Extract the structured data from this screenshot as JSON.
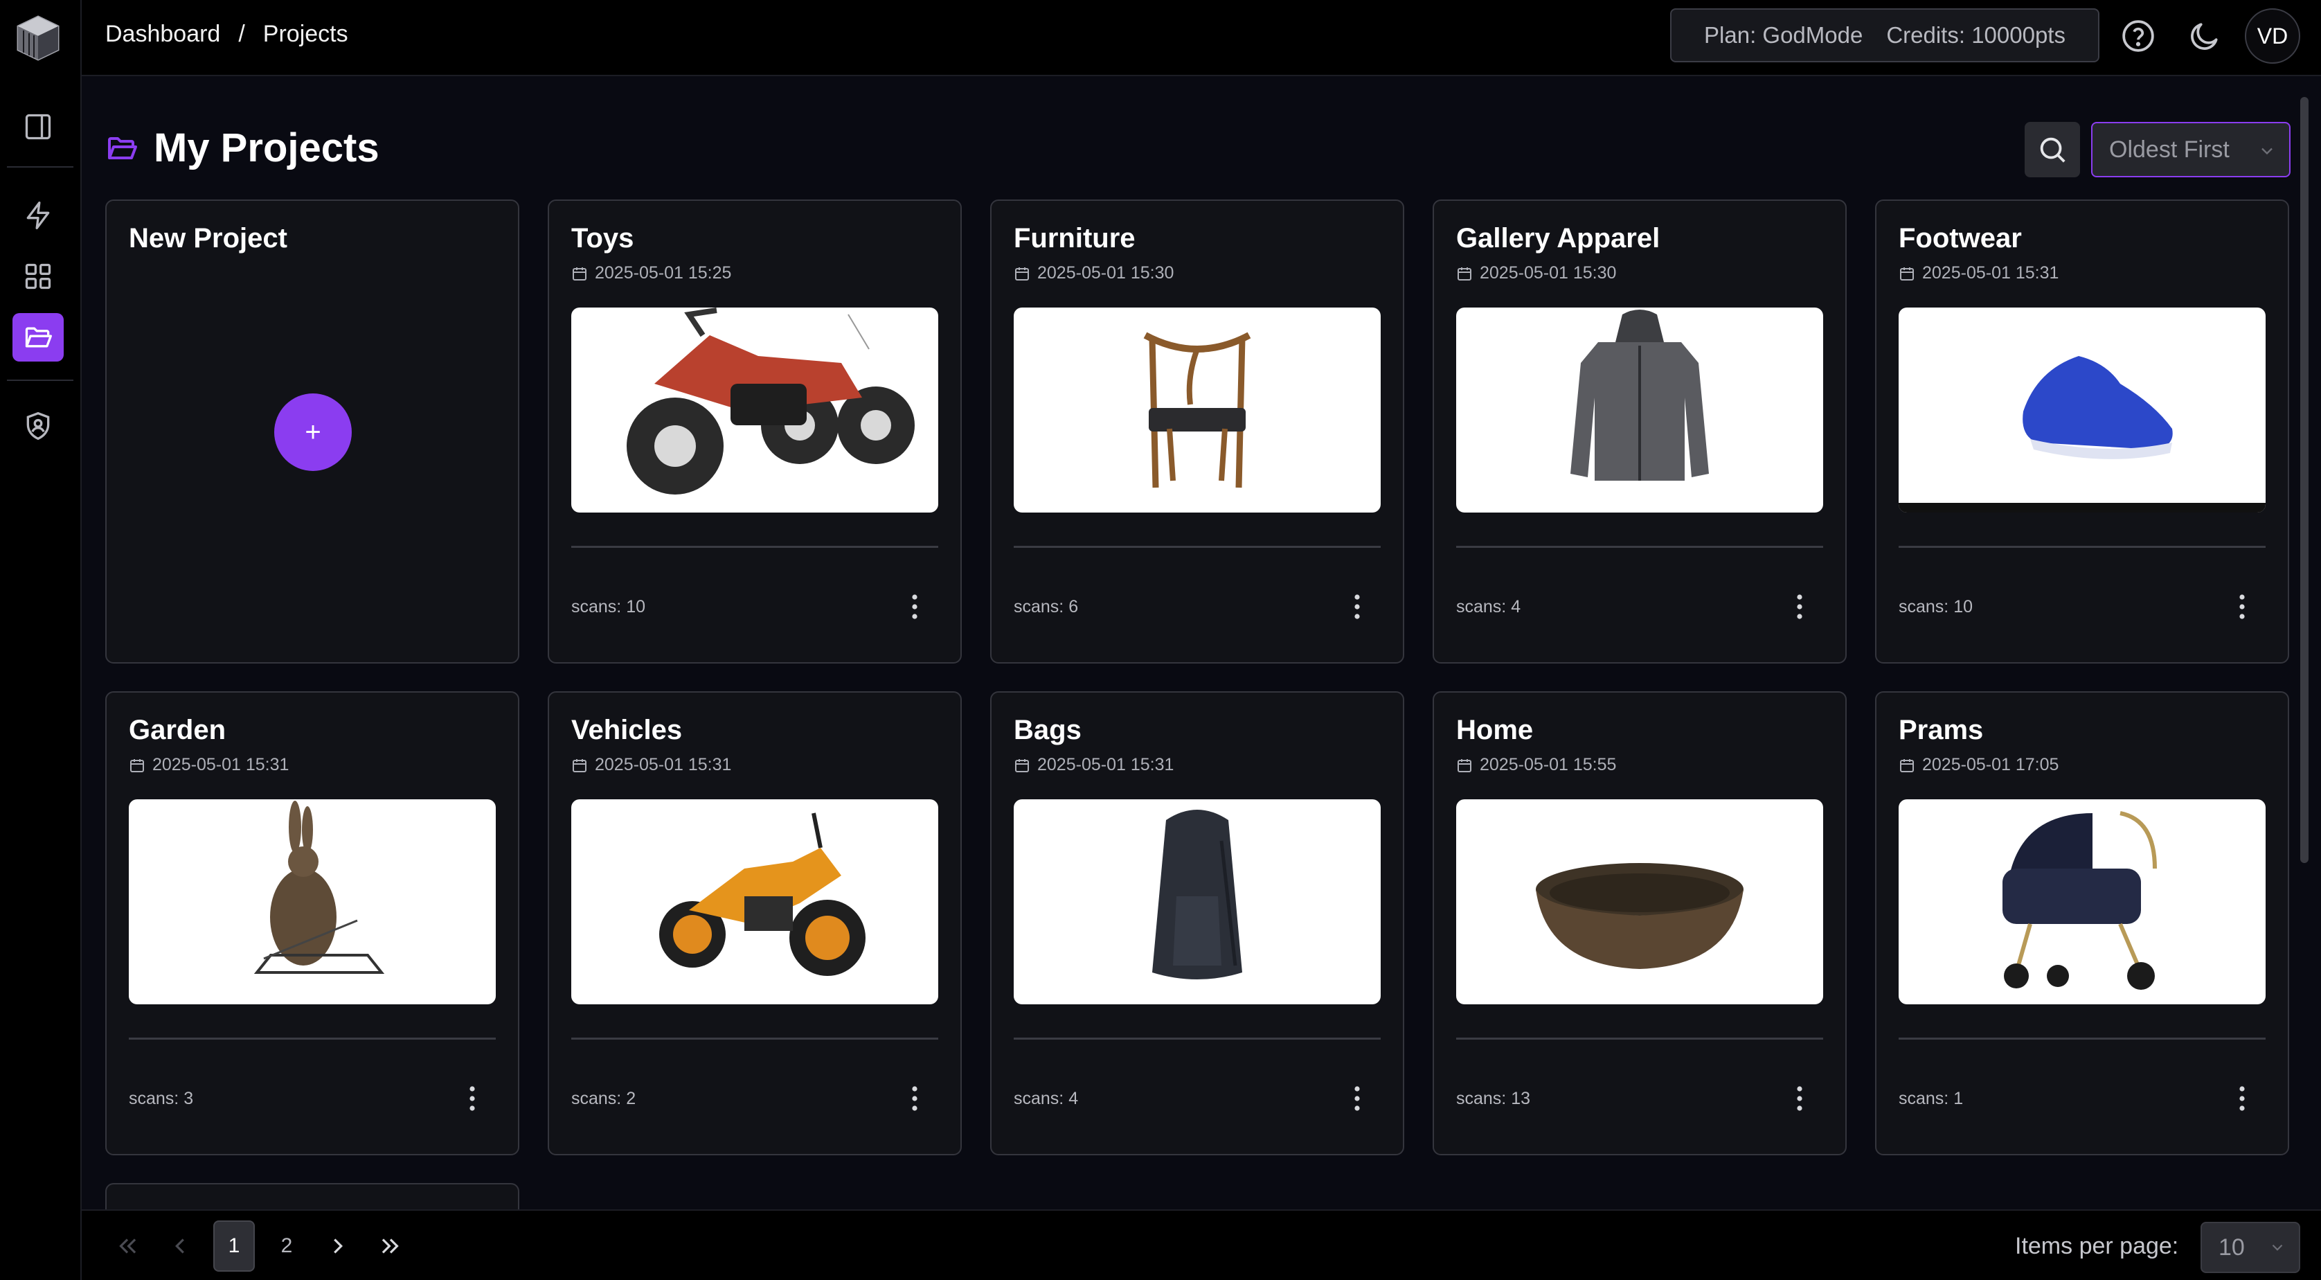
{
  "breadcrumb": {
    "home": "Dashboard",
    "separator": "/",
    "current": "Projects"
  },
  "header": {
    "plan": "Plan: GodMode",
    "credits": "Credits: 10000pts",
    "avatar_initials": "VD",
    "icons": [
      "help-circle-icon",
      "moon-icon"
    ]
  },
  "sidebar": {
    "items": [
      {
        "name": "sidebar-toggle",
        "icon": "panel-left-icon",
        "active": false
      },
      {
        "name": "quick-actions",
        "icon": "lightning-icon",
        "active": false
      },
      {
        "name": "dashboard-grid",
        "icon": "grid-icon",
        "active": false
      },
      {
        "name": "projects",
        "icon": "folder-open-icon",
        "active": true
      },
      {
        "name": "security",
        "icon": "shield-user-icon",
        "active": false
      }
    ]
  },
  "page": {
    "title": "My Projects",
    "sort": {
      "selected": "Oldest First"
    }
  },
  "new_project": {
    "title": "New Project",
    "plus": "+"
  },
  "projects": [
    {
      "title": "Toys",
      "date": "2025-05-01 15:25",
      "scans": "scans: 10",
      "thumb": "dirt-bike-toy"
    },
    {
      "title": "Furniture",
      "date": "2025-05-01 15:30",
      "scans": "scans: 6",
      "thumb": "wooden-chair"
    },
    {
      "title": "Gallery Apparel",
      "date": "2025-05-01 15:30",
      "scans": "scans: 4",
      "thumb": "grey-jacket"
    },
    {
      "title": "Footwear",
      "date": "2025-05-01 15:31",
      "scans": "scans: 10",
      "thumb": "blue-sneaker"
    },
    {
      "title": "Garden",
      "date": "2025-05-01 15:31",
      "scans": "scans: 3",
      "thumb": "hare-sculpture"
    },
    {
      "title": "Vehicles",
      "date": "2025-05-01 15:31",
      "scans": "scans: 2",
      "thumb": "motorcycle"
    },
    {
      "title": "Bags",
      "date": "2025-05-01 15:31",
      "scans": "scans: 4",
      "thumb": "backpack"
    },
    {
      "title": "Home",
      "date": "2025-05-01 15:55",
      "scans": "scans: 13",
      "thumb": "wooden-bowl"
    },
    {
      "title": "Prams",
      "date": "2025-05-01 17:05",
      "scans": "scans: 1",
      "thumb": "pram"
    }
  ],
  "pagination": {
    "pages": [
      "1",
      "2"
    ],
    "current": "1",
    "items_per_page_label": "Items per page:",
    "items_per_page": "10"
  },
  "colors": {
    "accent": "#8b3df0",
    "background": "#090a12",
    "card": "#111217",
    "border": "#34353d"
  }
}
